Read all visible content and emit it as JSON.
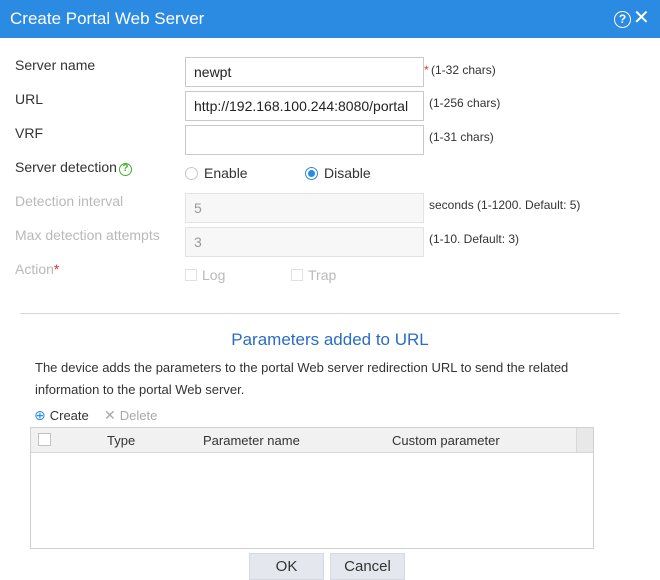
{
  "dialog": {
    "title": "Create Portal Web Server",
    "help_glyph": "?",
    "close_glyph": "✕"
  },
  "form": {
    "server_name": {
      "label": "Server name",
      "value": "newpt",
      "required_mark": "*",
      "hint": "(1-32 chars)"
    },
    "url": {
      "label": "URL",
      "value": "http://192.168.100.244:8080/portal",
      "hint": "(1-256 chars)"
    },
    "vrf": {
      "label": "VRF",
      "value": "",
      "hint": "(1-31 chars)"
    },
    "server_detection": {
      "label": "Server detection",
      "help_glyph": "?",
      "options": [
        "Enable",
        "Disable"
      ],
      "selected": "Disable"
    },
    "detection_interval": {
      "label": "Detection interval",
      "value": "5",
      "hint": "seconds (1-1200. Default: 5)"
    },
    "max_detection_attempts": {
      "label": "Max detection attempts",
      "value": "3",
      "hint": "(1-10. Default: 3)"
    },
    "action": {
      "label": "Action",
      "required_mark": "*",
      "options": [
        "Log",
        "Trap"
      ]
    }
  },
  "parameters": {
    "title": "Parameters added to URL",
    "description_line1": "The device adds the parameters to the portal Web server redirection URL to send the related",
    "description_line2": "information to the portal Web server.",
    "toolbar": {
      "create_label": "Create",
      "delete_label": "Delete",
      "create_icon": "plus-circle-icon",
      "delete_icon": "x-icon"
    },
    "columns": [
      "Type",
      "Parameter name",
      "Custom parameter"
    ],
    "rows": []
  },
  "footer": {
    "ok_label": "OK",
    "cancel_label": "Cancel"
  },
  "colors": {
    "titlebar": "#2b8ae2",
    "section_title": "#2b6cc4",
    "required": "#e62e2e",
    "help_green": "#41b02b"
  }
}
